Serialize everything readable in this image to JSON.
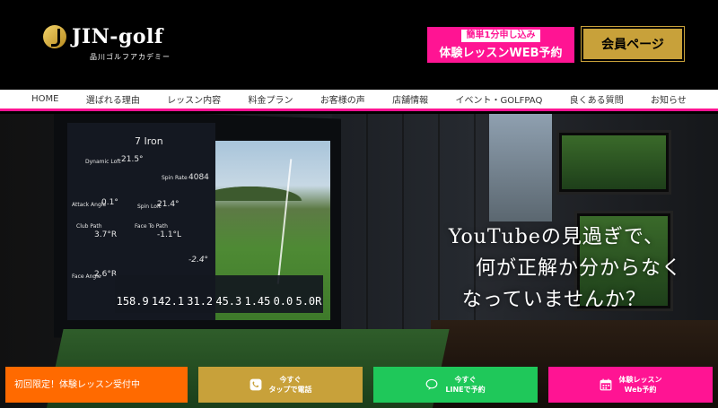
{
  "header": {
    "logo_text": "JIN-golf",
    "logo_sub": "品川ゴルフアカデミー",
    "trial_badge": "簡単1分申し込み",
    "trial_label": "体験レッスンWEB予約",
    "member_label": "会員ページ"
  },
  "nav": {
    "items": [
      "HOME",
      "選ばれる理由",
      "レッスン内容",
      "料金プラン",
      "お客様の声",
      "店舗情報",
      "イベント・GOLFPAQ",
      "良くある質問",
      "お知らせ"
    ]
  },
  "hero": {
    "line1": "YouTubeの見過ぎで、",
    "line2": "何が正解か分からなく",
    "line3": "なっていませんか？",
    "screen": {
      "club": "7 Iron",
      "dynamic_loft": "Dynamic Loft",
      "dynamic_loft_val": "21.5°",
      "spin_rate": "Spin Rate",
      "spin_rate_val": "4084",
      "attack_angle": "Attack Angle",
      "attack_angle_val": "0.1°",
      "spin_loft": "Spin Loft",
      "spin_loft_val": "21.4°",
      "club_path": "Club Path",
      "club_path_val": "3.7°R",
      "face_to_path": "Face To Path",
      "face_to_path_val": "-1.1°L",
      "spin_axis_val": "-2.4°",
      "face_angle": "Face Angle",
      "face_angle_val": "2.6°R",
      "stats": [
        "158.9",
        "142.1",
        "31.2",
        "45.3",
        "1.45",
        "0.0",
        "5.0R"
      ]
    }
  },
  "bottom_bar": {
    "limited": "初回限定！体験レッスン受付中",
    "phone": "今すぐ\nタップで電話",
    "line": "今すぐ\nLINEで予約",
    "web": "体験レッスン\nWeb予約"
  },
  "colors": {
    "accent_pink": "#ff1493",
    "gold": "#c8a13a",
    "orange": "#ff6a00",
    "line_green": "#1fc85a"
  }
}
